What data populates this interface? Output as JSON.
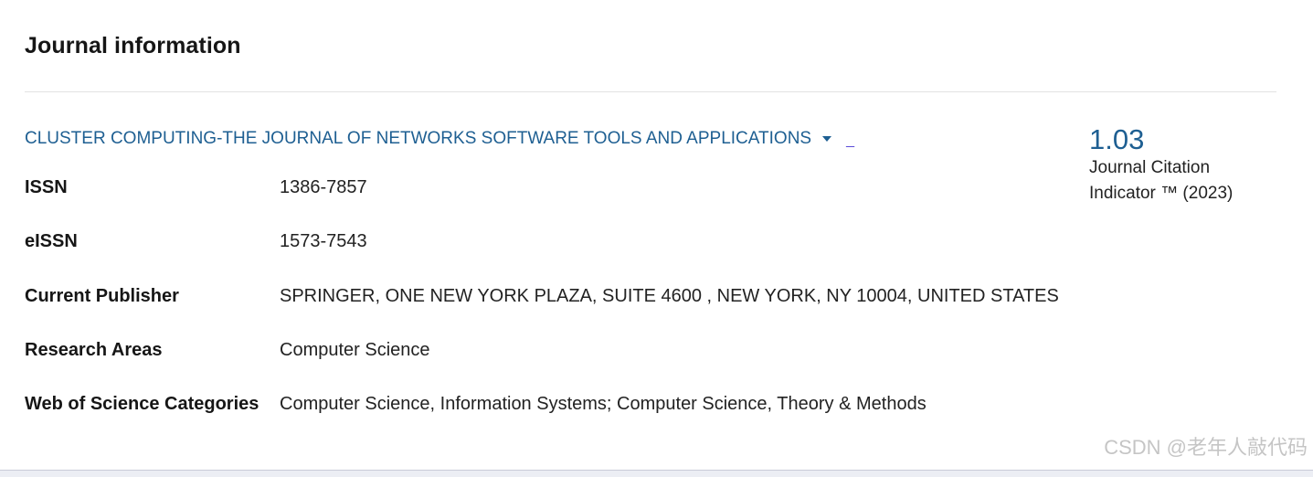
{
  "section": {
    "title": "Journal information"
  },
  "journal": {
    "name": "CLUSTER COMPUTING-THE JOURNAL OF NETWORKS SOFTWARE TOOLS AND APPLICATIONS",
    "ext_mark": "_"
  },
  "details": [
    {
      "label": "ISSN",
      "value": "1386-7857"
    },
    {
      "label": "eISSN",
      "value": "1573-7543"
    },
    {
      "label": "Current Publisher",
      "value": "SPRINGER, ONE NEW YORK PLAZA, SUITE 4600 , NEW YORK, NY 10004, UNITED STATES"
    },
    {
      "label": "Research Areas",
      "value": "Computer Science"
    },
    {
      "label": "Web of Science Categories",
      "value": "Computer Science, Information Systems; Computer Science, Theory & Methods"
    }
  ],
  "metric": {
    "value": "1.03",
    "label_line1": "Journal Citation",
    "label_line2": "Indicator ™ (2023)"
  },
  "watermark": "CSDN @老年人敲代码",
  "colors": {
    "link": "#1e5f92",
    "text": "#161616",
    "divider": "#e3e3e3"
  },
  "icons": {
    "dropdown": "caret-down-icon"
  }
}
